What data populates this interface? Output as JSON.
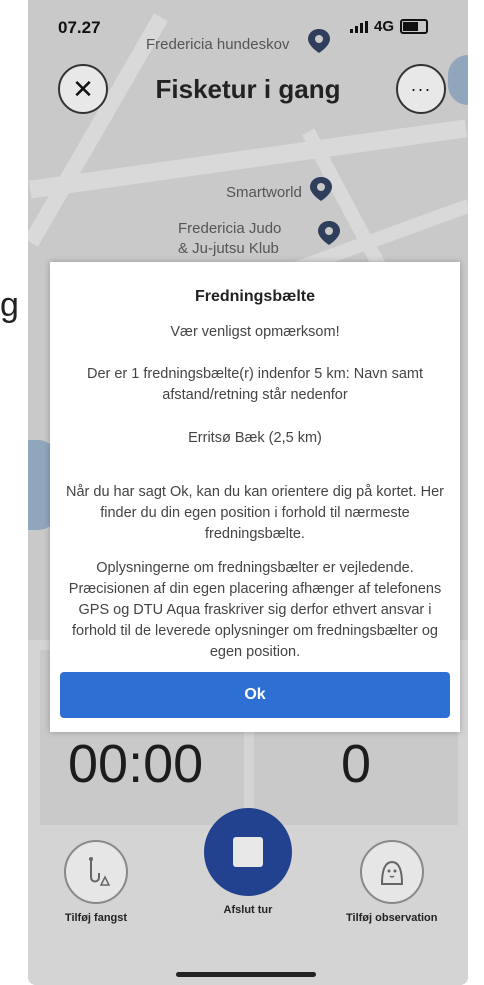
{
  "edge_glyph": "g",
  "status": {
    "time": "07.27",
    "network": "4G"
  },
  "header": {
    "title": "Fisketur i gang",
    "close_glyph": "✕",
    "more_glyph": "···"
  },
  "map": {
    "labels": [
      "Fredericia hundeskov",
      "Smartworld",
      "Fredericia Judo",
      "& Ju-jutsu Klub"
    ]
  },
  "dialog": {
    "title": "Fredningsbælte",
    "line1": "Vær venligst opmærksom!",
    "line2": "Der er 1 fredningsbælte(r) indenfor 5 km: Navn samt afstand/retning står nedenfor",
    "line3": "Erritsø Bæk (2,5 km)",
    "line4": "Når du har sagt Ok, kan du kan orientere dig på kortet. Her finder du din egen position i forhold til nærmeste fredningsbælte.",
    "line5": "Oplysningerne om fredningsbælter er vejledende. Præcisionen af din egen placering afhænger af telefonens GPS og DTU Aqua fraskriver sig derfor ethvert ansvar i forhold til de leverede oplysninger om fredningsbælter og egen position.",
    "ok_label": "Ok"
  },
  "stats": {
    "timer": "00:00",
    "count": "0"
  },
  "actions": {
    "add_catch": "Tilføj fangst",
    "end_trip": "Afslut tur",
    "add_observation": "Tilføj observation"
  },
  "colors": {
    "primary": "#2e6fd4",
    "stop_button": "#22418f",
    "pin": "#2f3e5b"
  }
}
